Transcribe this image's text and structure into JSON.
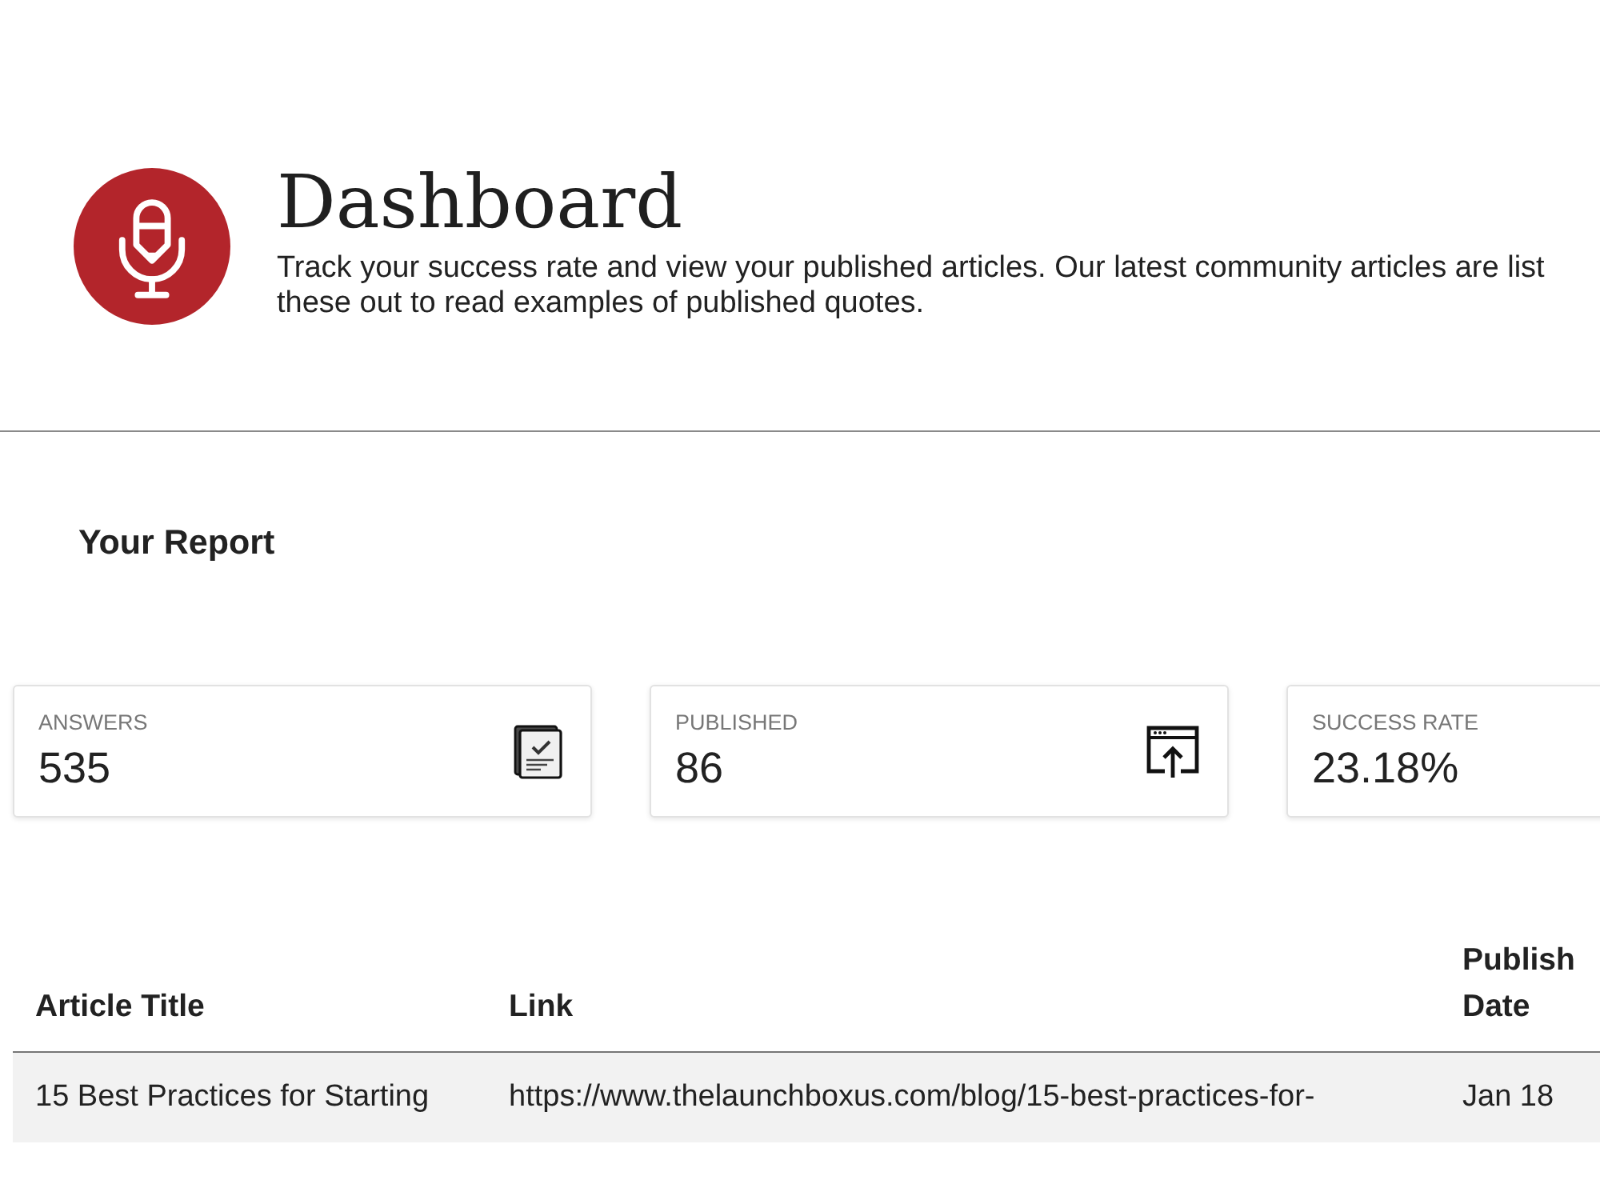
{
  "header": {
    "title": "Dashboard",
    "description": [
      "Track your success rate and view your published articles. Our latest community articles are list",
      "these out to read examples of published quotes."
    ]
  },
  "report": {
    "title": "Your Report",
    "cards": [
      {
        "kind": "answers",
        "label": "ANSWERS",
        "value": "535"
      },
      {
        "kind": "published",
        "label": "PUBLISHED",
        "value": "86"
      },
      {
        "kind": "success",
        "label": "SUCCESS RATE",
        "value": "23.18%"
      }
    ]
  },
  "table": {
    "columns": [
      "Article Title",
      "Link",
      "Publish Date"
    ],
    "rows": [
      [
        "15 Best Practices for Starting",
        "https://www.thelaunchboxus.com/blog/15-best-practices-for-",
        "Jan 18"
      ]
    ]
  }
}
